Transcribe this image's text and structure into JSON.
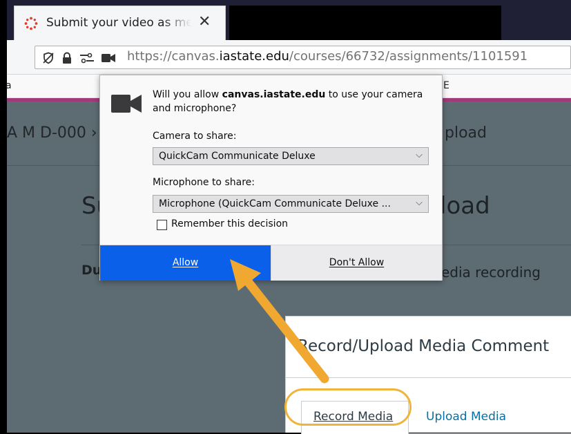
{
  "browser": {
    "tab_title": "Submit your video as media up",
    "tab_close": "✕",
    "url_prefix": "https://canvas.",
    "url_domain": "iastate.edu",
    "url_path": "/courses/66732/assignments/1101591"
  },
  "bookmarks": {
    "left_char": "a",
    "right_char": "E"
  },
  "page": {
    "breadcrumb_left": "A M D-000 ›",
    "breadcrumb_right": "pload",
    "title_left": "Su",
    "title_right": "load",
    "due_label": "Du",
    "media_recording": "edia recording"
  },
  "permission_popup": {
    "question_prefix": "Will you allow ",
    "question_domain": "canvas.iastate.edu",
    "question_suffix": " to use your camera and microphone?",
    "camera_label": "Camera to share:",
    "camera_value": "QuickCam Communicate Deluxe",
    "microphone_label": "Microphone to share:",
    "microphone_value": "Microphone (QuickCam Communicate Deluxe ...",
    "remember_label": "Remember this decision",
    "remember_checked": false,
    "allow_label": "Allow",
    "deny_label": "Don't Allow",
    "chevron": "⌵"
  },
  "media_dialog": {
    "title": "Record/Upload Media Comment",
    "tab_record": "Record Media",
    "tab_upload": "Upload Media"
  },
  "colors": {
    "allow_blue": "#0a60e8",
    "annotation_orange": "#f0a830",
    "canvas_purple": "#a03a7a"
  }
}
